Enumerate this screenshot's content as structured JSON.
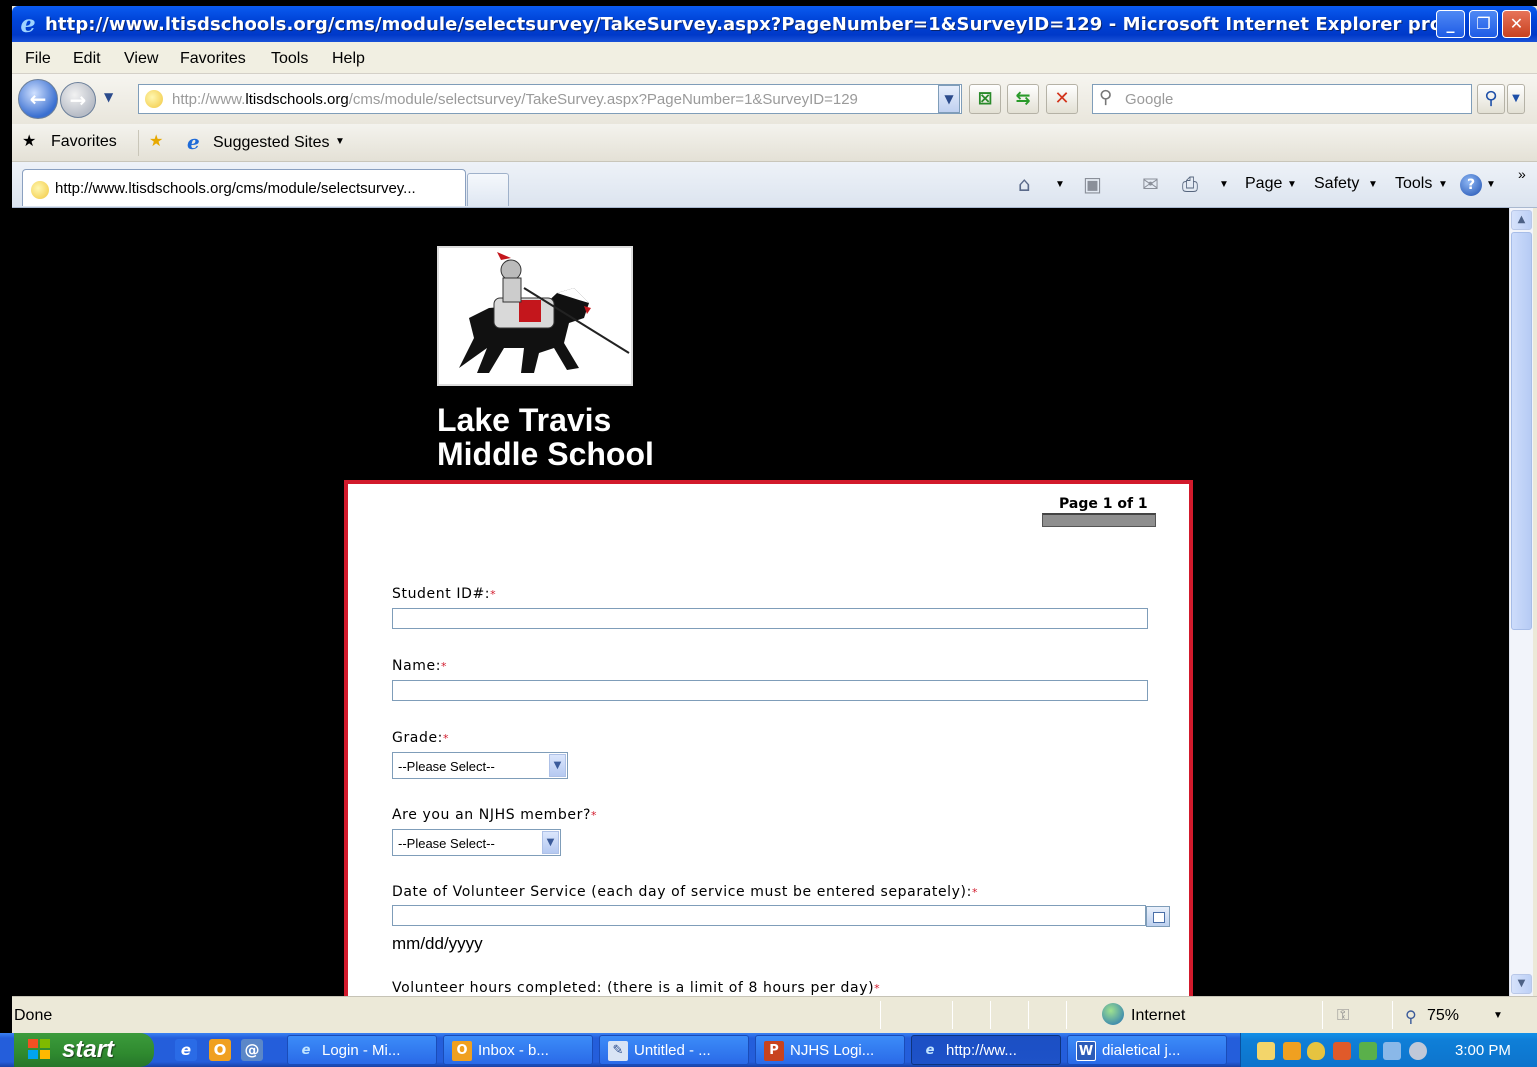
{
  "window": {
    "title": "http://www.ltisdschools.org/cms/module/selectsurvey/TakeSurvey.aspx?PageNumber=1&SurveyID=129 - Microsoft Internet Explorer pro",
    "controls": {
      "minimize": "_",
      "restore": "❐",
      "close": "✕"
    }
  },
  "menu": [
    "File",
    "Edit",
    "View",
    "Favorites",
    "Tools",
    "Help"
  ],
  "address": {
    "prefix": "http://www.",
    "domain": "ltisdschools.org",
    "path": "/cms/module/selectsurvey/TakeSurvey.aspx?PageNumber=1&SurveyID=129"
  },
  "search": {
    "placeholder": "Google"
  },
  "favorites_bar": {
    "favorites": "Favorites",
    "suggested": "Suggested Sites"
  },
  "tab": {
    "label": "http://www.ltisdschools.org/cms/module/selectsurvey..."
  },
  "command_bar": {
    "page": "Page",
    "safety": "Safety",
    "tools": "Tools"
  },
  "school": {
    "line1": "Lake Travis",
    "line2": "Middle School"
  },
  "survey": {
    "page_indicator": "Page 1 of 1",
    "required_mark": "*",
    "fields": {
      "student_id": "Student ID#:",
      "name": "Name:",
      "grade": "Grade:",
      "njhs": "Are you an NJHS member?",
      "date": "Date of Volunteer Service (each day of service must be entered separately):",
      "hours": "Volunteer hours completed: (there is a limit of 8 hours per day)"
    },
    "select_placeholder": "--Please Select--",
    "date_hint": "mm/dd/yyyy"
  },
  "status": {
    "text": "Done",
    "zone": "Internet",
    "zoom": "75%"
  },
  "taskbar": {
    "start": "start",
    "tasks": [
      "Login - Mi...",
      "Inbox - b...",
      "Untitled - ...",
      "NJHS Logi...",
      "http://ww...",
      "dialetical j..."
    ],
    "clock": "3:00 PM"
  },
  "colors": {
    "accent_red": "#d21a2c",
    "title_blue": "#0044D8"
  }
}
